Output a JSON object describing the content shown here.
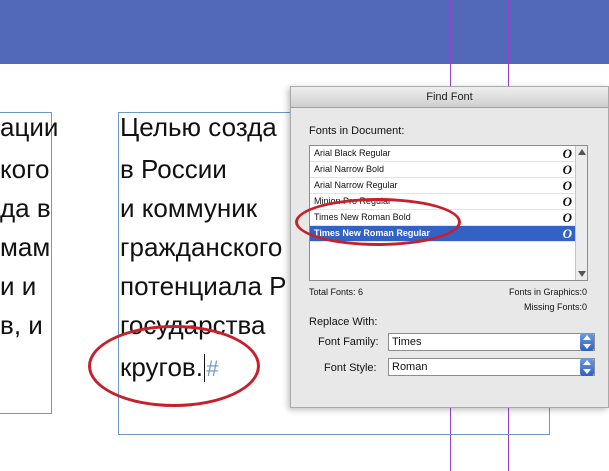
{
  "colors": {
    "banner": "#5169b8",
    "guide": "#9a3fc6",
    "frame": "#6f96c9",
    "ring": "#c8202a",
    "selection": "#3362c4"
  },
  "left_column": {
    "lines": [
      "ации",
      "кого",
      "да в",
      "мам",
      "и и",
      "в, и"
    ]
  },
  "main_text": {
    "lines": [
      "Целью созда",
      "в России",
      "и коммуник",
      "гражданского",
      "потенциала Р",
      "государства",
      "кругов."
    ],
    "end_mark": "#"
  },
  "dialog": {
    "title": "Find Font",
    "fonts_label": "Fonts in Document:",
    "fonts": [
      {
        "name": "Arial Black Regular",
        "icon": "opentype-icon",
        "selected": false
      },
      {
        "name": "Arial Narrow Bold",
        "icon": "opentype-icon",
        "selected": false
      },
      {
        "name": "Arial Narrow Regular",
        "icon": "opentype-icon",
        "selected": false
      },
      {
        "name": "Minion Pro Regular",
        "icon": "opentype-icon",
        "selected": false
      },
      {
        "name": "Times New Roman Bold",
        "icon": "opentype-icon",
        "selected": false
      },
      {
        "name": "Times New Roman Regular",
        "icon": "opentype-icon",
        "selected": true
      }
    ],
    "icon_glyph": "O",
    "total_fonts": "Total Fonts: 6",
    "fonts_in_graphics": "Fonts in Graphics:0",
    "missing_fonts": "Missing Fonts:0",
    "replace_with": "Replace With:",
    "font_family_label": "Font Family:",
    "font_family_value": "Times",
    "font_style_label": "Font Style:",
    "font_style_value": "Roman"
  }
}
